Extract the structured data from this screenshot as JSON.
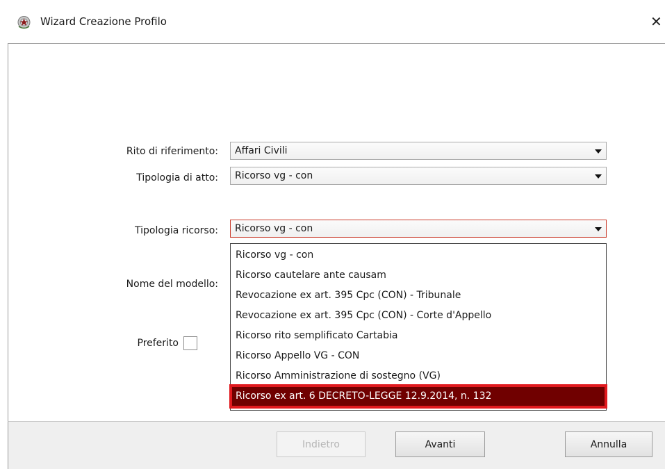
{
  "window": {
    "title": "Wizard Creazione Profilo",
    "close_glyph": "✕",
    "app_icon": "emblem-icon"
  },
  "form": {
    "rito_label": "Rito di riferimento:",
    "rito_value": "Affari Civili",
    "tipologia_atto_label": "Tipologia di atto:",
    "tipologia_atto_value": "Ricorso vg - con",
    "tipologia_ricorso_label": "Tipologia ricorso:",
    "tipologia_ricorso_value": "Ricorso vg - con",
    "nome_modello_label": "Nome del modello:",
    "preferito_label": "Preferito",
    "preferito_checked": false
  },
  "dropdown": {
    "items": [
      "Ricorso vg - con",
      "Ricorso cautelare ante causam",
      "Revocazione ex art. 395 Cpc (CON) - Tribunale",
      "Revocazione ex art. 395 Cpc (CON) - Corte d'Appello",
      "Ricorso rito semplificato Cartabia",
      "Ricorso Appello VG - CON",
      "Ricorso Amministrazione di sostegno (VG)",
      "Ricorso ex art. 6 DECRETO-LEGGE 12.9.2014, n. 132"
    ],
    "selected_index": 7,
    "highlight_color": "#e0191e"
  },
  "footer": {
    "back_label": "Indietro",
    "next_label": "Avanti",
    "cancel_label": "Annulla"
  }
}
